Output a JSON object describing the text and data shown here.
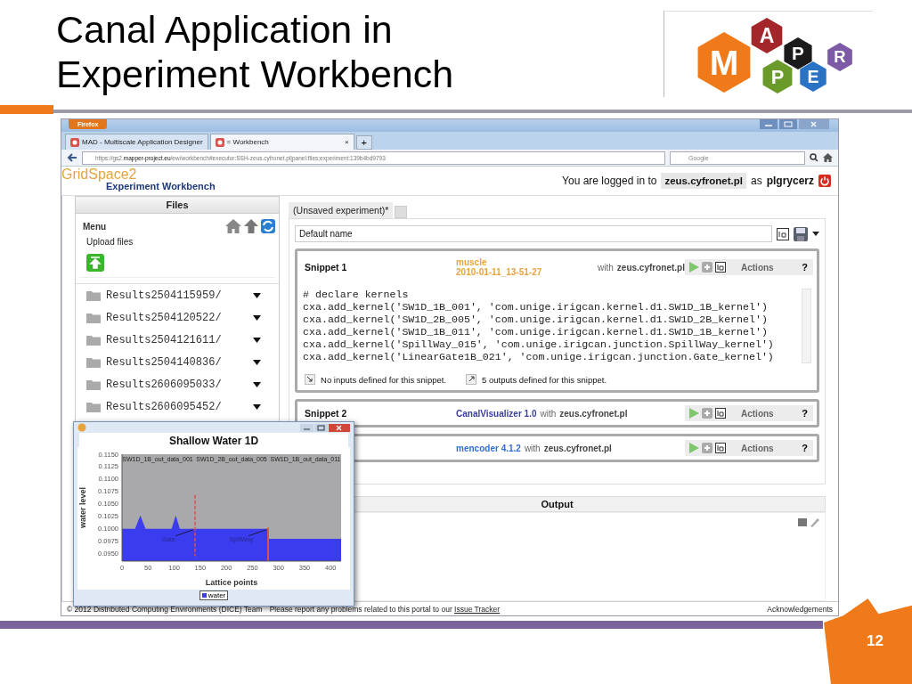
{
  "slide": {
    "title_lines": [
      "Canal Application in",
      "Experiment Workbench"
    ],
    "logo_letters": [
      "M",
      "A",
      "P",
      "P",
      "E",
      "R"
    ],
    "page_number": "12"
  },
  "browser": {
    "menu_button": "Firefox",
    "tabs": [
      {
        "label": "MAD - Multiscale Application Designer",
        "selected": false
      },
      {
        "label": "= Workbench",
        "selected": true
      }
    ],
    "tab_close": "×",
    "new_tab": "+",
    "url_start": "https://gs2.",
    "url_domain": "mapper-project.eu",
    "url_rest": "/ew/workbench#executor:SSH-zeus.cyfronet.pl|panel:files;experiment:139b4bd9793",
    "search_placeholder": "Google"
  },
  "app": {
    "logo_text": "GridSpace2",
    "subtitle": "Experiment Workbench",
    "login_prefix": "You are logged in to",
    "host": "zeus.cyfronet.pl",
    "as_word": "as",
    "user": "plgrycerz"
  },
  "files": {
    "title": "Files",
    "menu": "Menu",
    "upload": "Upload files",
    "items": [
      "Results2504115959/",
      "Results2504120522/",
      "Results2504121611/",
      "Results2504140836/",
      "Results2606095033/",
      "Results2606095452/"
    ]
  },
  "experiment": {
    "tab": "(Unsaved experiment)*",
    "name_value": "Default name",
    "snippets": [
      {
        "kind": "expanded",
        "title": "Snippet 1",
        "app": "muscle",
        "version": "2010-01-11_13-51-27",
        "color": "#e8a33c",
        "with_word": "with",
        "host": "zeus.cyfronet.pl",
        "actions": "Actions",
        "help": "?",
        "code": [
          "# declare kernels",
          "cxa.add_kernel('SW1D_1B_001', 'com.unige.irigcan.kernel.d1.SW1D_1B_kernel')",
          "cxa.add_kernel('SW1D_2B_005', 'com.unige.irigcan.kernel.d1.SW1D_2B_kernel')",
          "cxa.add_kernel('SW1D_1B_011', 'com.unige.irigcan.kernel.d1.SW1D_1B_kernel')",
          "cxa.add_kernel('SpillWay_015', 'com.unige.irigcan.junction.SpillWay_kernel')",
          "cxa.add_kernel('LinearGate1B_021', 'com.unige.irigcan.junction.Gate_kernel')"
        ],
        "inputs": "No inputs defined for this snippet.",
        "outputs": "5 outputs defined for this snippet."
      },
      {
        "kind": "collapsed",
        "title": "Snippet 2",
        "app": "CanalVisualizer 1.0",
        "color": "#3a3f9e",
        "with_word": "with",
        "host": "zeus.cyfronet.pl",
        "actions": "Actions",
        "help": "?"
      },
      {
        "kind": "collapsed",
        "app": "mencoder 4.1.2",
        "color": "#2f6fd0",
        "with_word": "with",
        "host": "zeus.cyfronet.pl",
        "actions": "Actions",
        "help": "?"
      }
    ],
    "output_title": "Output"
  },
  "footer": {
    "copyright": "© 2012 Distributed Computing Environments (DICE) Team",
    "report": "Please report any problems related to this portal to our",
    "link": "Issue Tracker",
    "acknowledgements": "Acknowledgements"
  },
  "chart_window": {
    "title": "Shallow Water 1D",
    "section_labels": [
      "SW1D_1B_out_data_001",
      "SW1D_2B_out_data_005",
      "SW1D_1B_out_data_011"
    ],
    "chart_data": {
      "type": "area",
      "xlabel": "Lattice points",
      "ylabel": "water level",
      "x": [
        0,
        25,
        35,
        45,
        95,
        103,
        111,
        140,
        280,
        281,
        420
      ],
      "series": [
        {
          "name": "water",
          "color": "#3b3bf0",
          "values": [
            0.1,
            0.1,
            0.1027,
            0.1,
            0.1,
            0.1027,
            0.1,
            0.1,
            0.1,
            0.098,
            0.098
          ]
        }
      ],
      "xlim": [
        0,
        420
      ],
      "ylim": [
        0.0935,
        0.115
      ],
      "xticks": [
        0,
        50,
        100,
        150,
        200,
        250,
        300,
        350,
        400
      ],
      "yticks": [
        {
          "value": 0.095,
          "label": "0.0950"
        },
        {
          "value": 0.0975,
          "label": "0.0975"
        },
        {
          "value": 0.1,
          "label": "0.1000"
        },
        {
          "value": 0.1025,
          "label": "0.1025"
        },
        {
          "value": 0.105,
          "label": "0.1050"
        },
        {
          "value": 0.1075,
          "label": "0.1075"
        },
        {
          "value": 0.11,
          "label": "0.1100"
        },
        {
          "value": 0.1125,
          "label": "0.1125"
        },
        {
          "value": 0.115,
          "label": "0.1150"
        }
      ],
      "annotations": [
        {
          "text": "Gate",
          "x": 140,
          "y": 0.1
        },
        {
          "text": "SpillWay",
          "x": 280,
          "y": 0.1
        }
      ]
    }
  }
}
